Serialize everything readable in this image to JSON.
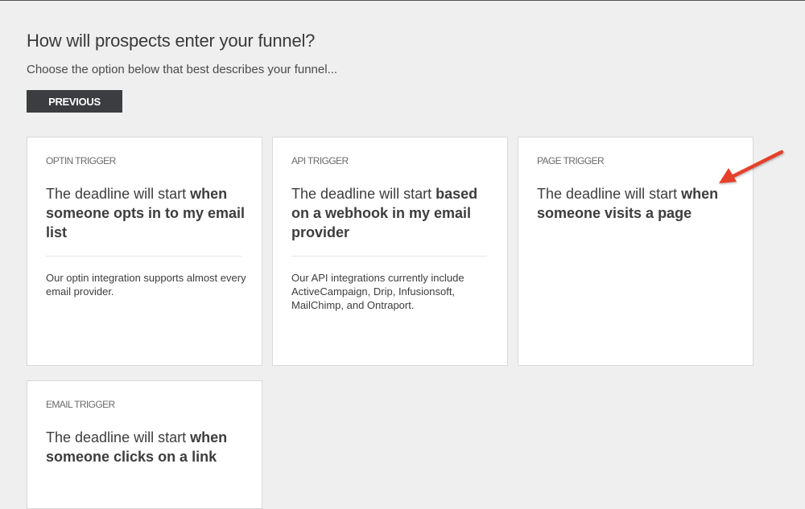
{
  "header": {
    "title": "How will prospects enter your funnel?",
    "subtitle": "Choose the option below that best describes your funnel..."
  },
  "toolbar": {
    "previous_label": "PREVIOUS"
  },
  "cards": [
    {
      "label": "OPTIN TRIGGER",
      "heading_plain": "The deadline will start ",
      "heading_strong": "when someone opts in to my email list",
      "description": "Our optin integration supports almost every email provider."
    },
    {
      "label": "API TRIGGER",
      "heading_plain": "The deadline will start ",
      "heading_strong": "based on a webhook in my email provider",
      "description": "Our API integrations currently include ActiveCampaign, Drip, Infusionsoft, MailChimp, and Ontraport."
    },
    {
      "label": "PAGE TRIGGER",
      "heading_plain": "The deadline will start ",
      "heading_strong": "when someone visits a page",
      "description": ""
    },
    {
      "label": "EMAIL TRIGGER",
      "heading_plain": "The deadline will start ",
      "heading_strong": "when someone clicks on a link",
      "description": ""
    }
  ],
  "annotation": {
    "arrow_icon": "arrow-pointer-icon",
    "color": "#e5402b"
  }
}
